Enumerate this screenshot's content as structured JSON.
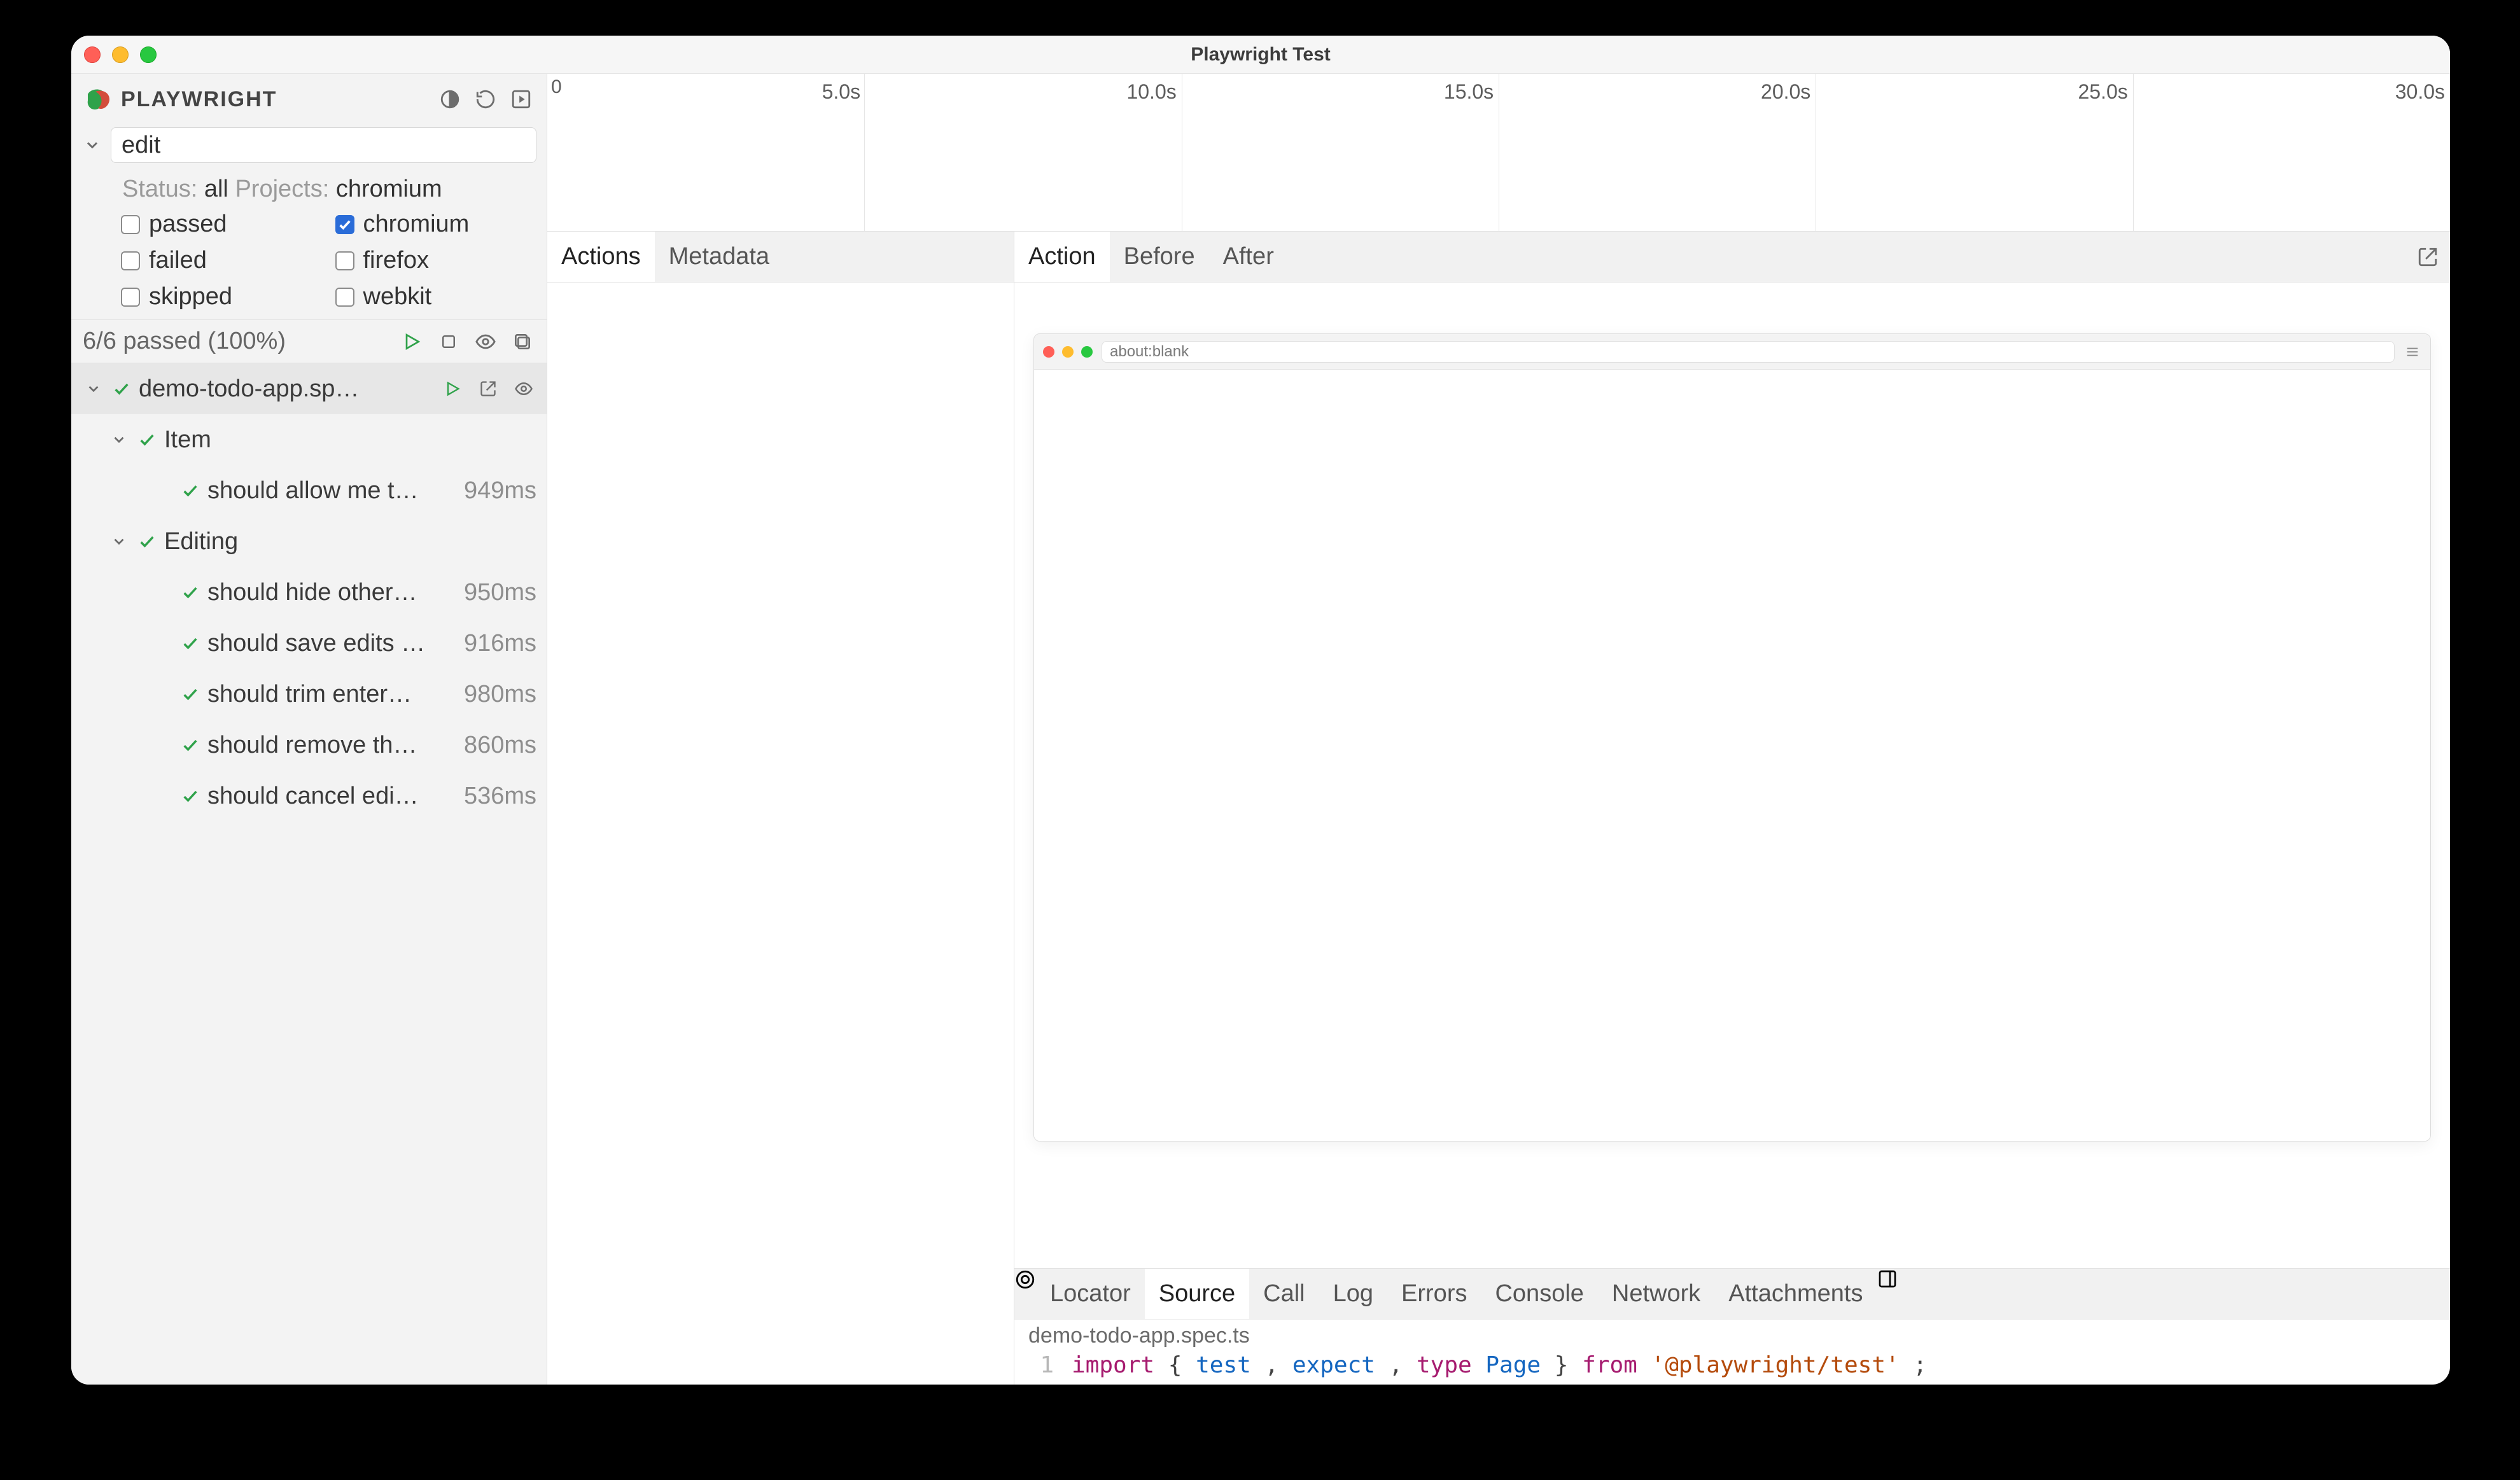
{
  "window": {
    "title": "Playwright Test"
  },
  "sidebar": {
    "brand": "PLAYWRIGHT",
    "search_value": "edit",
    "status_label": "Status:",
    "status_value": "all",
    "projects_label": "Projects:",
    "projects_value": "chromium",
    "filters": {
      "passed": {
        "label": "passed",
        "checked": false
      },
      "failed": {
        "label": "failed",
        "checked": false
      },
      "skipped": {
        "label": "skipped",
        "checked": false
      },
      "chromium": {
        "label": "chromium",
        "checked": true
      },
      "firefox": {
        "label": "firefox",
        "checked": false
      },
      "webkit": {
        "label": "webkit",
        "checked": false
      }
    },
    "summary": "6/6 passed (100%)"
  },
  "tree": {
    "file": {
      "label": "demo-todo-app.sp…"
    },
    "groups": [
      {
        "label": "Item",
        "tests": [
          {
            "label": "should allow me t…",
            "time": "949ms"
          }
        ]
      },
      {
        "label": "Editing",
        "tests": [
          {
            "label": "should hide other…",
            "time": "950ms"
          },
          {
            "label": "should save edits …",
            "time": "916ms"
          },
          {
            "label": "should trim enter…",
            "time": "980ms"
          },
          {
            "label": "should remove th…",
            "time": "860ms"
          },
          {
            "label": "should cancel edi…",
            "time": "536ms"
          }
        ]
      }
    ]
  },
  "timeline": {
    "zero": "0",
    "ticks": [
      "5.0s",
      "10.0s",
      "15.0s",
      "20.0s",
      "25.0s",
      "30.0s"
    ]
  },
  "left_tabs": {
    "actions": "Actions",
    "metadata": "Metadata"
  },
  "right_tabs": {
    "action": "Action",
    "before": "Before",
    "after": "After"
  },
  "browser": {
    "url": "about:blank"
  },
  "bottom_tabs": {
    "locator": "Locator",
    "source": "Source",
    "call": "Call",
    "log": "Log",
    "errors": "Errors",
    "console": "Console",
    "network": "Network",
    "attachments": "Attachments"
  },
  "source": {
    "filename": "demo-todo-app.spec.ts",
    "line_no": "1",
    "tokens": {
      "import": "import",
      "lb": "{",
      "test": "test",
      "c1": ",",
      "expect": "expect",
      "c2": ",",
      "type": "type",
      "page": "Page",
      "rb": "}",
      "from": "from",
      "pkg": "'@playwright/test'",
      "semi": ";"
    }
  }
}
